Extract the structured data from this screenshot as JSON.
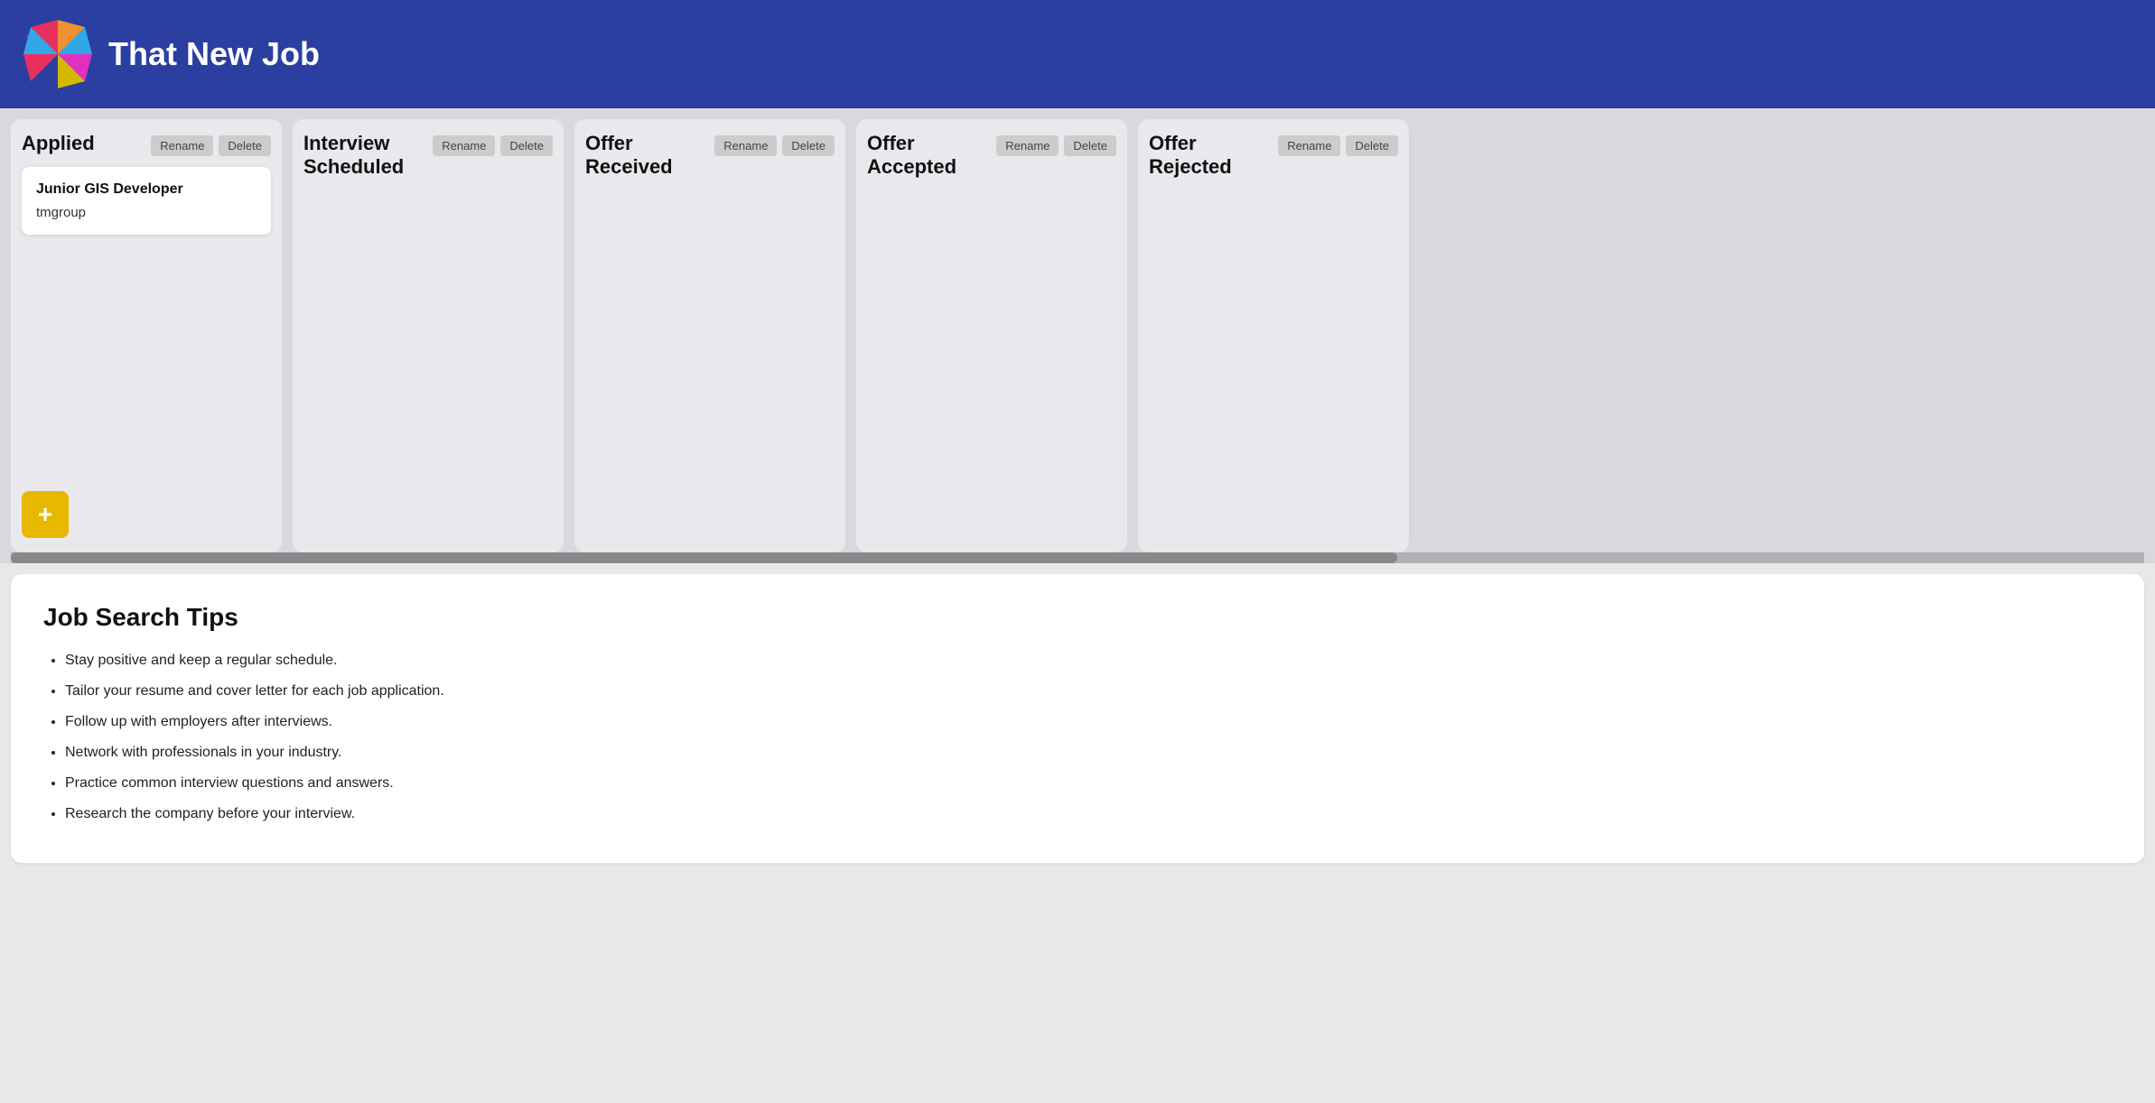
{
  "header": {
    "title": "That New Job",
    "logo_colors": [
      "#e83030",
      "#f09030",
      "#30a8e8",
      "#e830c8",
      "#e8e820"
    ]
  },
  "board": {
    "columns": [
      {
        "id": "applied",
        "title": "Applied",
        "rename_label": "Rename",
        "delete_label": "Delete",
        "cards": [
          {
            "job_title": "Junior GIS Developer",
            "company": "tmgroup"
          }
        ],
        "add_btn_label": "+"
      },
      {
        "id": "interview-scheduled",
        "title": "Interview Scheduled",
        "rename_label": "Rename",
        "delete_label": "Delete",
        "cards": []
      },
      {
        "id": "offer-received",
        "title": "Offer Received",
        "rename_label": "Rename",
        "delete_label": "Delete",
        "cards": []
      },
      {
        "id": "offer-accepted",
        "title": "Offer Accepted",
        "rename_label": "Rename",
        "delete_label": "Delete",
        "cards": []
      },
      {
        "id": "offer-rejected",
        "title": "Offer Rejected",
        "rename_label": "Rename",
        "delete_label": "Delete",
        "cards": []
      }
    ]
  },
  "tips": {
    "title": "Job Search Tips",
    "items": [
      "Stay positive and keep a regular schedule.",
      "Tailor your resume and cover letter for each job application.",
      "Follow up with employers after interviews.",
      "Network with professionals in your industry.",
      "Practice common interview questions and answers.",
      "Research the company before your interview."
    ]
  }
}
